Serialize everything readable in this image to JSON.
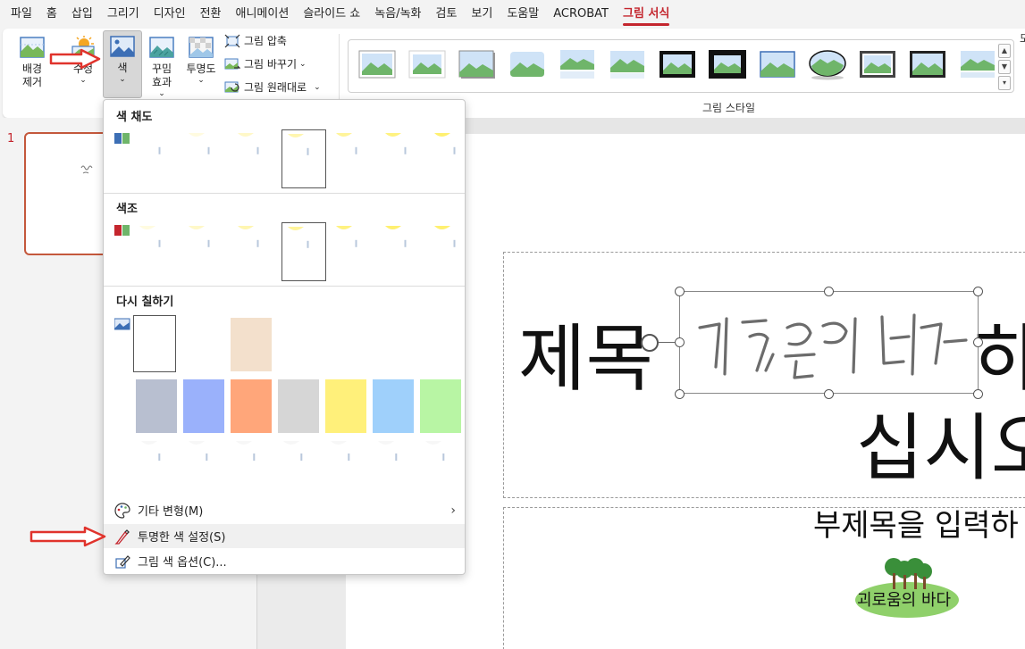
{
  "tabs": [
    {
      "id": "file",
      "label": "파일"
    },
    {
      "id": "home",
      "label": "홈"
    },
    {
      "id": "insert",
      "label": "삽입"
    },
    {
      "id": "draw",
      "label": "그리기"
    },
    {
      "id": "design",
      "label": "디자인"
    },
    {
      "id": "transitions",
      "label": "전환"
    },
    {
      "id": "animations",
      "label": "애니메이션"
    },
    {
      "id": "slideshow",
      "label": "슬라이드 쇼"
    },
    {
      "id": "record",
      "label": "녹음/녹화"
    },
    {
      "id": "review",
      "label": "검토"
    },
    {
      "id": "view",
      "label": "보기"
    },
    {
      "id": "help",
      "label": "도움말"
    },
    {
      "id": "acrobat",
      "label": "ACROBAT"
    },
    {
      "id": "picture_format",
      "label": "그림 서식"
    }
  ],
  "ribbon": {
    "remove_bg": {
      "line1": "배경",
      "line2": "제거"
    },
    "corrections": {
      "label": "수정"
    },
    "color": {
      "label": "색"
    },
    "artistic": {
      "line1": "꾸밈",
      "line2": "효과"
    },
    "transparency": {
      "label": "투명도"
    },
    "compress": {
      "label": "그림 압축"
    },
    "change": {
      "label": "그림 바꾸기"
    },
    "reset": {
      "label": "그림 원래대로"
    },
    "styles_group_label": "그림 스타일",
    "right_cut": "모"
  },
  "slides": {
    "current_number": "1"
  },
  "slide": {
    "title_line1_left": "제목",
    "title_line1_right": "하",
    "title_line2": "십시오",
    "subtitle": "부제목을 입력하",
    "logo_text": "괴로움의 바다",
    "signature_text": "괴로움의 바다"
  },
  "color_menu": {
    "saturation_header": "색 채도",
    "tone_header": "색조",
    "recolor_header": "다시 칠하기",
    "more_variations": "기타 변형(M)",
    "set_transparent": "투명한 색 설정(S)",
    "picture_color_options": "그림 색 옵션(C)...",
    "recolor_colors": [
      "#b8bfd0",
      "#9ab1fb",
      "#ffa67a",
      "#d6d6d6",
      "#fff07a",
      "#9fd0fb",
      "#b8f5a4"
    ]
  },
  "colors": {
    "accent": "#c4262e",
    "arrow_red": "#e0332c"
  }
}
